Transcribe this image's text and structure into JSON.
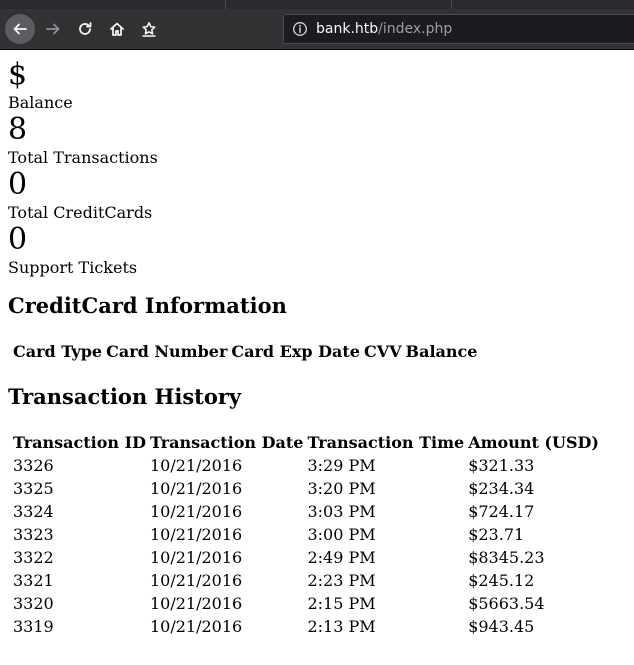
{
  "browser": {
    "url_host": "bank.htb",
    "url_path": "/index.php"
  },
  "stats": [
    {
      "value": "$",
      "label": "Balance"
    },
    {
      "value": "8",
      "label": "Total Transactions"
    },
    {
      "value": "0",
      "label": "Total CreditCards"
    },
    {
      "value": "0",
      "label": "Support Tickets"
    }
  ],
  "creditcard": {
    "title": "CreditCard Information",
    "headers": [
      "Card Type",
      "Card Number",
      "Card Exp Date",
      "CVV",
      "Balance"
    ]
  },
  "transactions": {
    "title": "Transaction History",
    "headers": [
      "Transaction ID",
      "Transaction Date",
      "Transaction Time",
      "Amount (USD)"
    ],
    "rows": [
      [
        "3326",
        "10/21/2016",
        "3:29 PM",
        "$321.33"
      ],
      [
        "3325",
        "10/21/2016",
        "3:20 PM",
        "$234.34"
      ],
      [
        "3324",
        "10/21/2016",
        "3:03 PM",
        "$724.17"
      ],
      [
        "3323",
        "10/21/2016",
        "3:00 PM",
        "$23.71"
      ],
      [
        "3322",
        "10/21/2016",
        "2:49 PM",
        "$8345.23"
      ],
      [
        "3321",
        "10/21/2016",
        "2:23 PM",
        "$245.12"
      ],
      [
        "3320",
        "10/21/2016",
        "2:15 PM",
        "$5663.54"
      ],
      [
        "3319",
        "10/21/2016",
        "2:13 PM",
        "$943.45"
      ]
    ]
  }
}
